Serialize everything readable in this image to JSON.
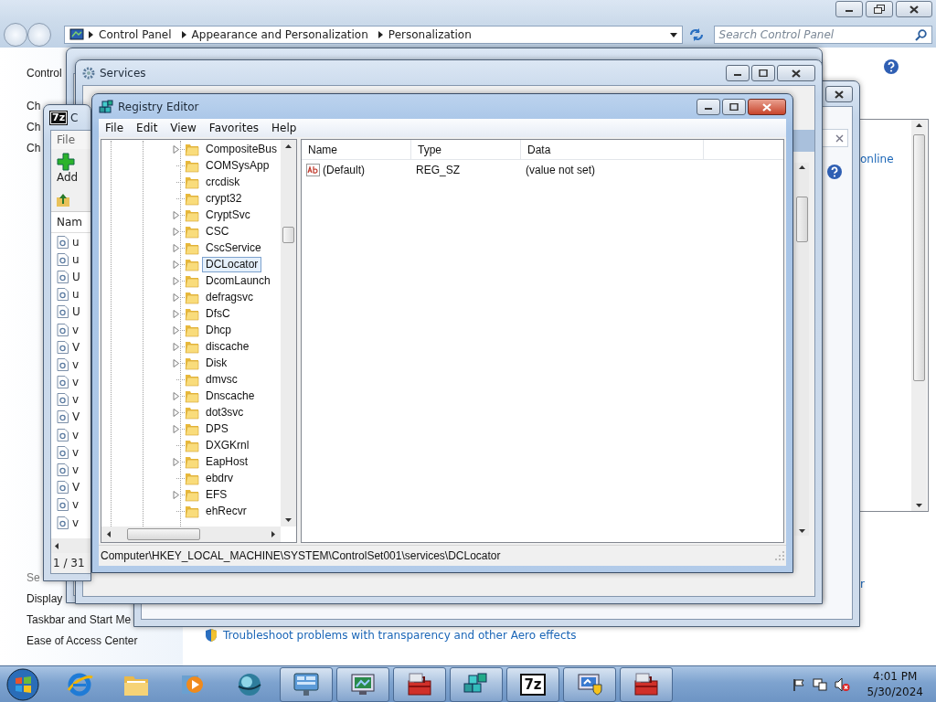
{
  "control_panel": {
    "breadcrumb": [
      "Control Panel",
      "Appearance and Personalization",
      "Personalization"
    ],
    "search": {
      "placeholder": "Search Control Panel"
    },
    "nav_top": [
      "Control",
      "Ch",
      "Ch",
      "Ch"
    ],
    "nav_bottom": [
      "Se",
      "Display",
      "Taskbar and Start Me",
      "Ease of Access Center"
    ],
    "online_link": "online",
    "fragment_link": "r",
    "troubleshoot_link": "Troubleshoot problems with transparency and other Aero effects"
  },
  "services_window": {
    "title": "Services"
  },
  "seven_zip": {
    "title": "C",
    "icon_label": "7z",
    "menu": [
      "File"
    ],
    "toolbar": [
      "Add"
    ],
    "column": "Nam",
    "rows": [
      "u",
      "u",
      "U",
      "u",
      "U",
      "v",
      "V",
      "v",
      "v",
      "v",
      "V",
      "v",
      "v",
      "v",
      "V",
      "v",
      "v"
    ],
    "status": "1 / 31"
  },
  "registry_editor": {
    "title": "Registry Editor",
    "menu": [
      "File",
      "Edit",
      "View",
      "Favorites",
      "Help"
    ],
    "tree": [
      {
        "label": "CompositeBus",
        "expandable": true,
        "selected": false
      },
      {
        "label": "COMSysApp",
        "expandable": false,
        "selected": false
      },
      {
        "label": "crcdisk",
        "expandable": false,
        "selected": false
      },
      {
        "label": "crypt32",
        "expandable": false,
        "selected": false
      },
      {
        "label": "CryptSvc",
        "expandable": true,
        "selected": false
      },
      {
        "label": "CSC",
        "expandable": true,
        "selected": false
      },
      {
        "label": "CscService",
        "expandable": true,
        "selected": false
      },
      {
        "label": "DCLocator",
        "expandable": true,
        "selected": true
      },
      {
        "label": "DcomLaunch",
        "expandable": true,
        "selected": false
      },
      {
        "label": "defragsvc",
        "expandable": true,
        "selected": false
      },
      {
        "label": "DfsC",
        "expandable": true,
        "selected": false
      },
      {
        "label": "Dhcp",
        "expandable": true,
        "selected": false
      },
      {
        "label": "discache",
        "expandable": true,
        "selected": false
      },
      {
        "label": "Disk",
        "expandable": true,
        "selected": false
      },
      {
        "label": "dmvsc",
        "expandable": false,
        "selected": false
      },
      {
        "label": "Dnscache",
        "expandable": true,
        "selected": false
      },
      {
        "label": "dot3svc",
        "expandable": true,
        "selected": false
      },
      {
        "label": "DPS",
        "expandable": true,
        "selected": false
      },
      {
        "label": "DXGKrnl",
        "expandable": false,
        "selected": false
      },
      {
        "label": "EapHost",
        "expandable": true,
        "selected": false
      },
      {
        "label": "ebdrv",
        "expandable": false,
        "selected": false
      },
      {
        "label": "EFS",
        "expandable": true,
        "selected": false
      },
      {
        "label": "ehRecvr",
        "expandable": false,
        "selected": false
      }
    ],
    "columns": [
      "Name",
      "Type",
      "Data"
    ],
    "values": [
      {
        "name": "(Default)",
        "type": "REG_SZ",
        "data": "(value not set)"
      }
    ],
    "status_bar": "Computer\\HKEY_LOCAL_MACHINE\\SYSTEM\\ControlSet001\\services\\DCLocator"
  },
  "taskbar": {
    "apps": [
      {
        "kind": "browser",
        "running": false
      },
      {
        "kind": "folder",
        "running": false
      },
      {
        "kind": "media",
        "running": false
      },
      {
        "kind": "globe",
        "running": false
      },
      {
        "kind": "control-panel",
        "running": true
      },
      {
        "kind": "monitor",
        "running": true
      },
      {
        "kind": "toolbox",
        "running": true
      },
      {
        "kind": "registry",
        "running": true
      },
      {
        "kind": "archiver",
        "label": "7z",
        "running": true
      },
      {
        "kind": "monitor-shield",
        "running": true
      },
      {
        "kind": "toolbox",
        "running": true
      }
    ],
    "time": "4:01 PM",
    "date": "5/30/2024"
  }
}
